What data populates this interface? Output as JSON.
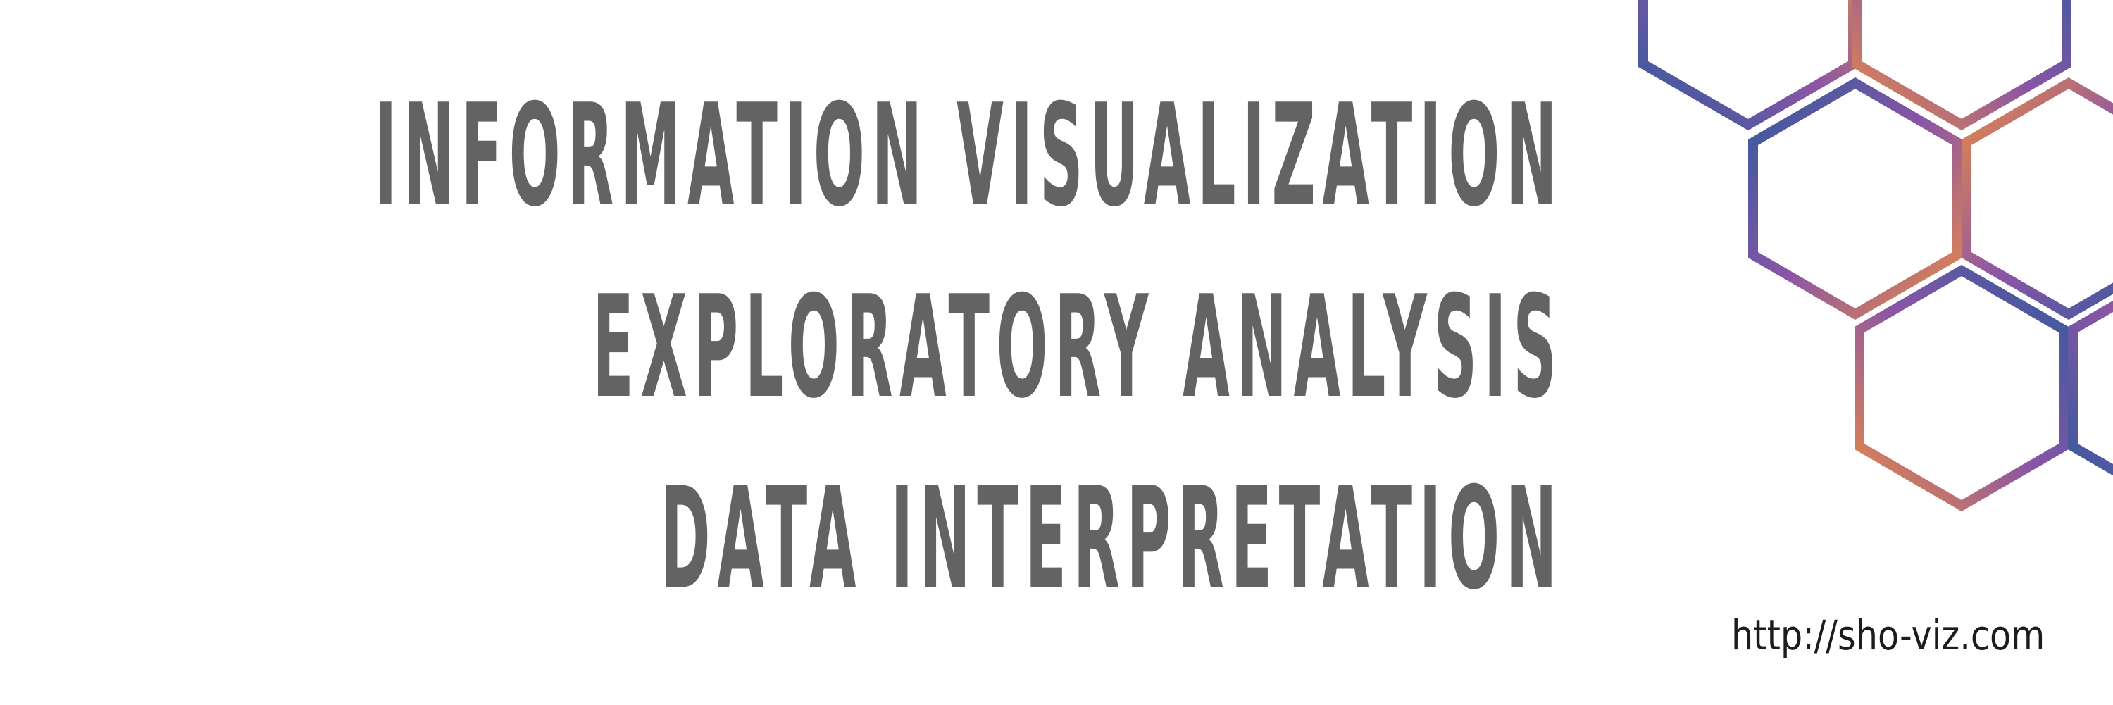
{
  "headlines": [
    "INFORMATION VISUALIZATION",
    "EXPLORATORY ANALYSIS",
    "DATA INTERPRETATION"
  ],
  "url": "http://sho-viz.com",
  "colors": {
    "text": "#636363",
    "hex_orange": "#e98b45",
    "hex_purple": "#8a55a6",
    "hex_blue": "#2f5b9d"
  },
  "decoration": "hexagon-pattern"
}
